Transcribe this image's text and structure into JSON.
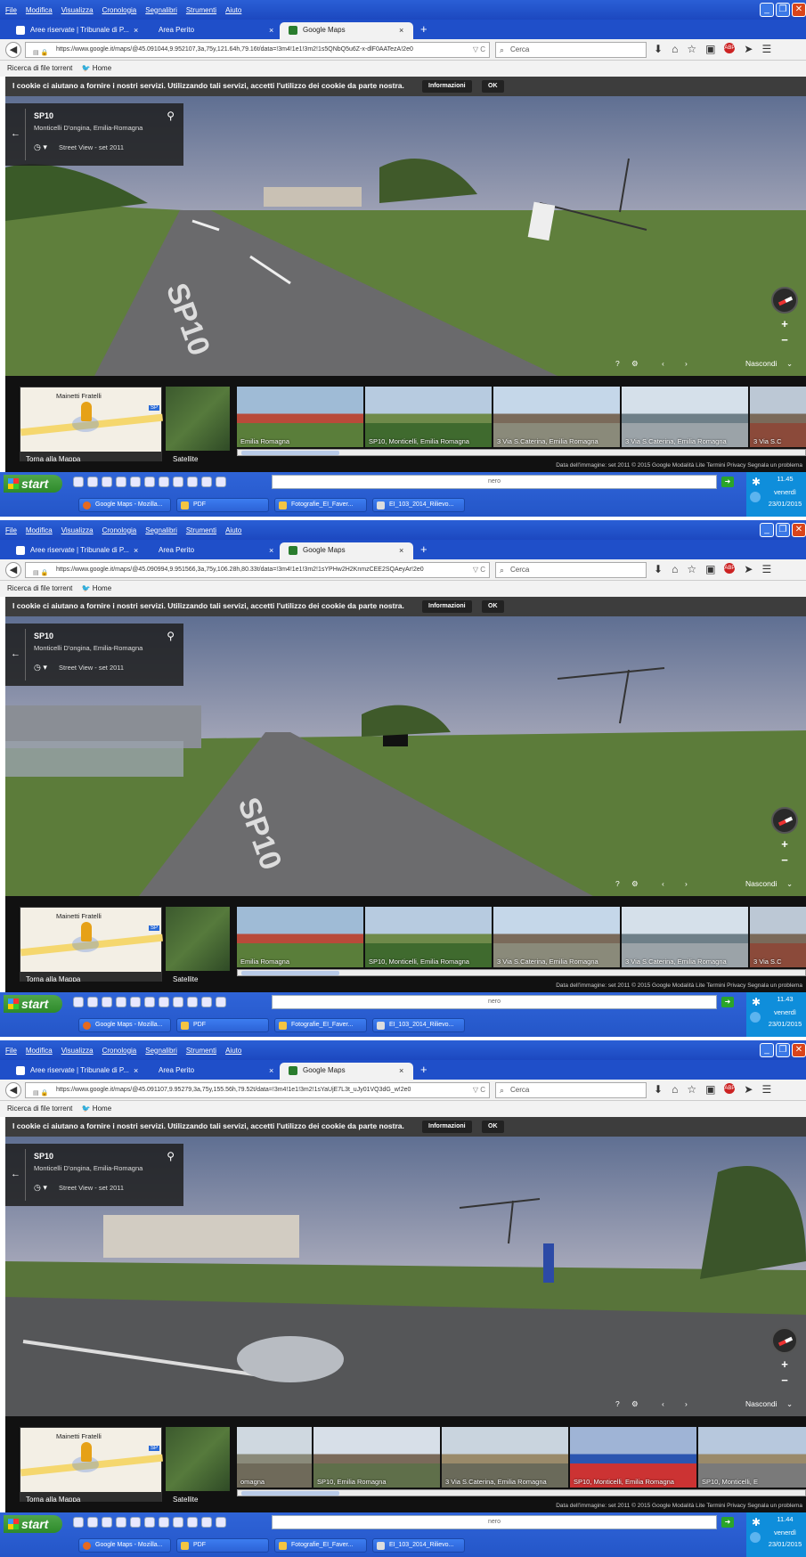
{
  "menu": [
    "File",
    "Modifica",
    "Visualizza",
    "Cronologia",
    "Segnalibri",
    "Strumenti",
    "Aiuto"
  ],
  "tabs": [
    {
      "label": "Aree riservate | Tribunale di P...",
      "close": "×"
    },
    {
      "label": "Area Perito",
      "close": "×"
    },
    {
      "label": "Google Maps",
      "close": "×"
    }
  ],
  "new_tab": "+",
  "bookmarks": {
    "item1": "Ricerca di file torrent",
    "item2": "Home"
  },
  "search_placeholder": "Cerca",
  "cookie": {
    "text": "I cookie ci aiutano a fornire i nostri servizi. Utilizzando tali servizi, accetti l'utilizzo dei cookie da parte nostra.",
    "info": "Informazioni",
    "ok": "OK"
  },
  "location": {
    "road": "SP10",
    "place": "Monticelli D'ongina, Emilia-Romagna",
    "sv": "Street View - set 2011"
  },
  "controls": {
    "hide": "Nascondi",
    "help": "?",
    "prev": "‹",
    "next": "›",
    "plus": "+",
    "minus": "−"
  },
  "minimap": {
    "label": "Mainetti Fratelli",
    "sp": "SP",
    "back": "Torna alla Mappa",
    "satellite": "Satellite"
  },
  "footer": "Data dell'immagine: set 2011    © 2015 Google    Modalità Lite    Termini    Privacy    Segnala un problema",
  "taskbar": {
    "start": "start",
    "nero": "nero",
    "day": "venerdì",
    "date": "23/01/2015",
    "tasks": [
      "Google Maps - Mozilla...",
      "PDF",
      "Fotografie_EI_Faver...",
      "EI_103_2014_Rilievo..."
    ]
  },
  "shots": [
    {
      "url": "https://www.google.it/maps/@45.091044,9.952107,3a,75y,121.64h,79.16t/data=!3m4!1e1!3m2!1s5QNbQ5u6Z-x-dlF0AATezA!2e0",
      "time": "11.45",
      "thumbs": [
        "Emilia Romagna",
        "SP10, Monticelli, Emilia Romagna",
        "3 Via S.Caterina, Emilia Romagna",
        "3 Via S.Caterina, Emilia Romagna",
        "3 Via S.C"
      ]
    },
    {
      "url": "https://www.google.it/maps/@45.090994,9.951566,3a,75y,106.28h,80.33t/data=!3m4!1e1!3m2!1sYPHw2H2KnmzCEE2SQAeyAr!2e0",
      "time": "11.43",
      "thumbs": [
        "Emilia Romagna",
        "SP10, Monticelli, Emilia Romagna",
        "3 Via S.Caterina, Emilia Romagna",
        "3 Via S.Caterina, Emilia Romagna",
        "3 Via S.C"
      ]
    },
    {
      "url": "https://www.google.it/maps/@45.091107,9.95279,3a,75y,155.56h,79.52t/data=!3m4!1e1!3m2!1sYaUjE7L3t_uJy01VQ3dG_w!2e0",
      "time": "11.44",
      "thumbs": [
        "omagna",
        "SP10, Emilia Romagna",
        "3 Via S.Caterina, Emilia Romagna",
        "SP10, Monticelli, Emilia Romagna",
        "SP10, Monticelli, E"
      ]
    }
  ],
  "colors": {
    "xp_blue": "#1f4fc9",
    "start_green": "#3a9a36",
    "tray": "#0f8edb",
    "cookie_bar": "#3d3d3d"
  }
}
